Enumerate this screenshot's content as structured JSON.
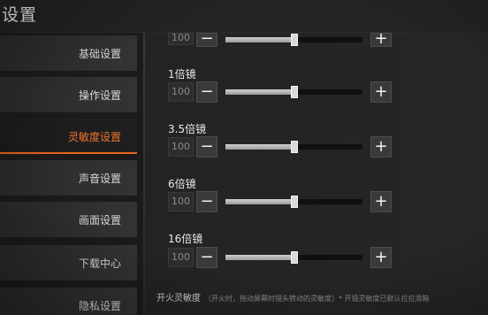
{
  "window": {
    "title": "设置"
  },
  "sidebar": {
    "items": [
      {
        "label": "基础设置",
        "active": false
      },
      {
        "label": "操作设置",
        "active": false
      },
      {
        "label": "灵敏度设置",
        "active": true
      },
      {
        "label": "声音设置",
        "active": false
      },
      {
        "label": "画面设置",
        "active": false
      },
      {
        "label": "下载中心",
        "active": false
      },
      {
        "label": "隐私设置",
        "active": false
      }
    ]
  },
  "sensitivity": {
    "partial_row": {
      "value": "100",
      "level": 0.5
    },
    "rows": [
      {
        "label": "1倍镜",
        "value": "100",
        "level": 0.5
      },
      {
        "label": "3.5倍镜",
        "value": "100",
        "level": 0.5
      },
      {
        "label": "6倍镜",
        "value": "100",
        "level": 0.5
      },
      {
        "label": "16倍镜",
        "value": "100",
        "level": 0.5
      }
    ],
    "minus_symbol": "−",
    "plus_symbol": "+"
  },
  "footer": {
    "title": "开火灵敏度",
    "note": "（开火时，拖动屏幕时镜头转动的灵敏度）* 开镜灵敏度已默认拉拉滑箱"
  },
  "colors": {
    "accent": "#e8631c"
  }
}
